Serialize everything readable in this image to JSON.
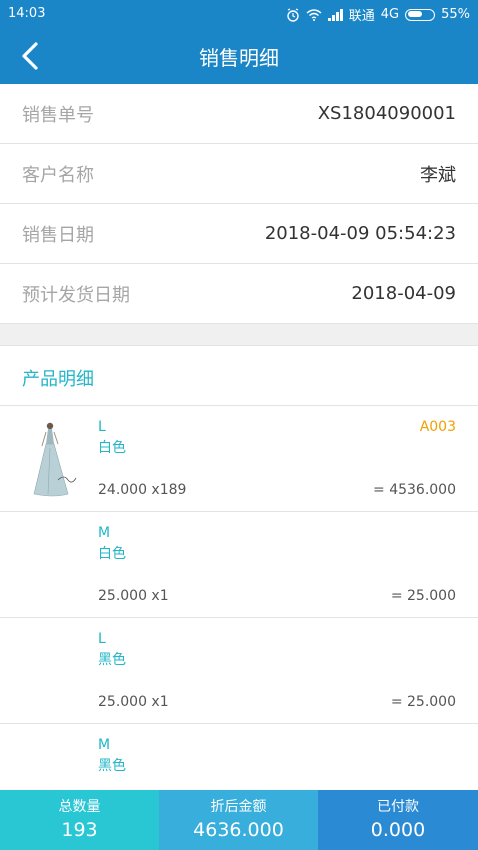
{
  "status_bar": {
    "time": "14:03",
    "carrier": "联通",
    "network": "4G",
    "battery": "55%",
    "icons": [
      "alarm-icon",
      "wifi-icon",
      "signal-icon",
      "battery-icon"
    ]
  },
  "nav": {
    "title": "销售明细",
    "back_icon": "chevron-left-icon"
  },
  "info": {
    "order_no_label": "销售单号",
    "order_no": "XS1804090001",
    "customer_label": "客户名称",
    "customer": "李斌",
    "sale_date_label": "销售日期",
    "sale_date": "2018-04-09 05:54:23",
    "ship_date_label": "预计发货日期",
    "ship_date": "2018-04-09"
  },
  "products": {
    "title": "产品明细",
    "items": [
      {
        "size": "L",
        "color": "白色",
        "code": "A003",
        "qty": "24.000 x189",
        "amount": "= 4536.000"
      },
      {
        "size": "M",
        "color": "白色",
        "code": "",
        "qty": "25.000 x1",
        "amount": "= 25.000"
      },
      {
        "size": "L",
        "color": "黑色",
        "code": "",
        "qty": "25.000 x1",
        "amount": "= 25.000"
      },
      {
        "size": "M",
        "color": "黑色",
        "code": "",
        "qty": "",
        "amount": ""
      }
    ]
  },
  "footer": {
    "total_qty_label": "总数量",
    "total_qty": "193",
    "discount_amount_label": "折后金额",
    "discount_amount": "4636.000",
    "paid_label": "已付款",
    "paid": "0.000"
  },
  "colors": {
    "header": "#1a86c8",
    "accent": "#22b6c8",
    "code": "#f0a000",
    "footer_1": "#29c6d4",
    "footer_2": "#37aedc",
    "footer_3": "#2a8ad4"
  }
}
